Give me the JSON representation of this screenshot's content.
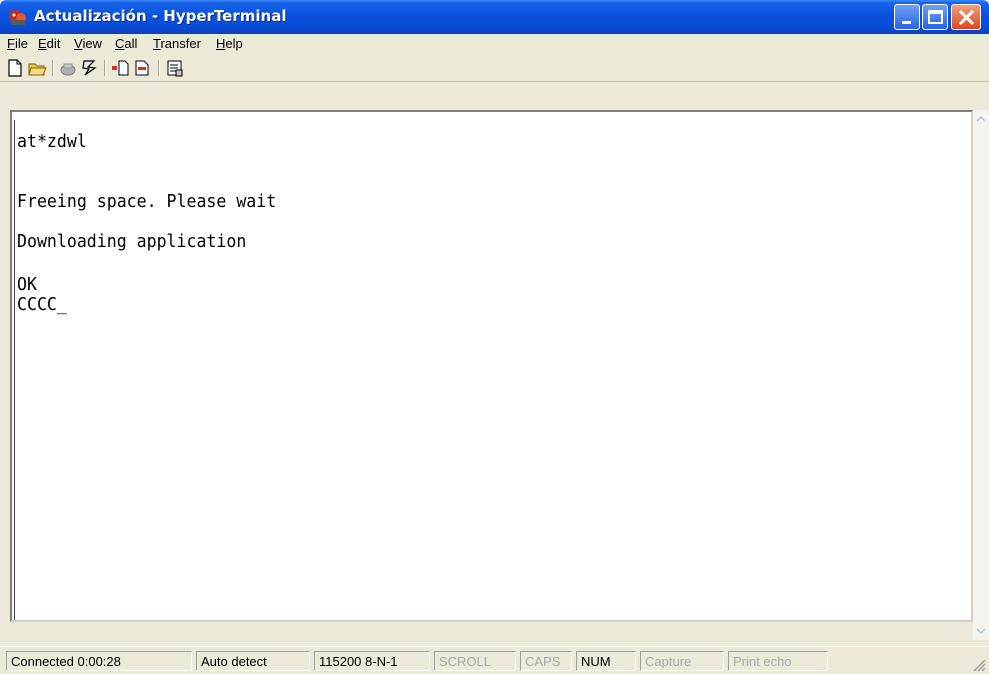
{
  "window": {
    "title": "Actualización - HyperTerminal",
    "accent_color": "#0a54e0"
  },
  "menu": {
    "file": {
      "key": "F",
      "rest": "ile"
    },
    "edit": {
      "key": "E",
      "rest": "dit"
    },
    "view": {
      "key": "V",
      "rest": "iew"
    },
    "call": {
      "key": "C",
      "rest": "all"
    },
    "transfer": {
      "key": "T",
      "rest": "ransfer"
    },
    "help": {
      "key": "H",
      "rest": "elp"
    }
  },
  "toolbar": {
    "icons": [
      "new-connection-icon",
      "open-icon",
      "disconnect-icon",
      "call-icon",
      "send-icon",
      "receive-icon",
      "properties-icon"
    ]
  },
  "terminal": {
    "lines": [
      "at*zdwl",
      "Freeing space. Please wait",
      "Downloading application",
      "OK",
      "CCCC_"
    ]
  },
  "status": {
    "connected": "Connected 0:00:28",
    "detect": "Auto detect",
    "baud": "115200 8-N-1",
    "scroll": "SCROLL",
    "caps": "CAPS",
    "num": "NUM",
    "capture": "Capture",
    "print_echo": "Print echo"
  }
}
